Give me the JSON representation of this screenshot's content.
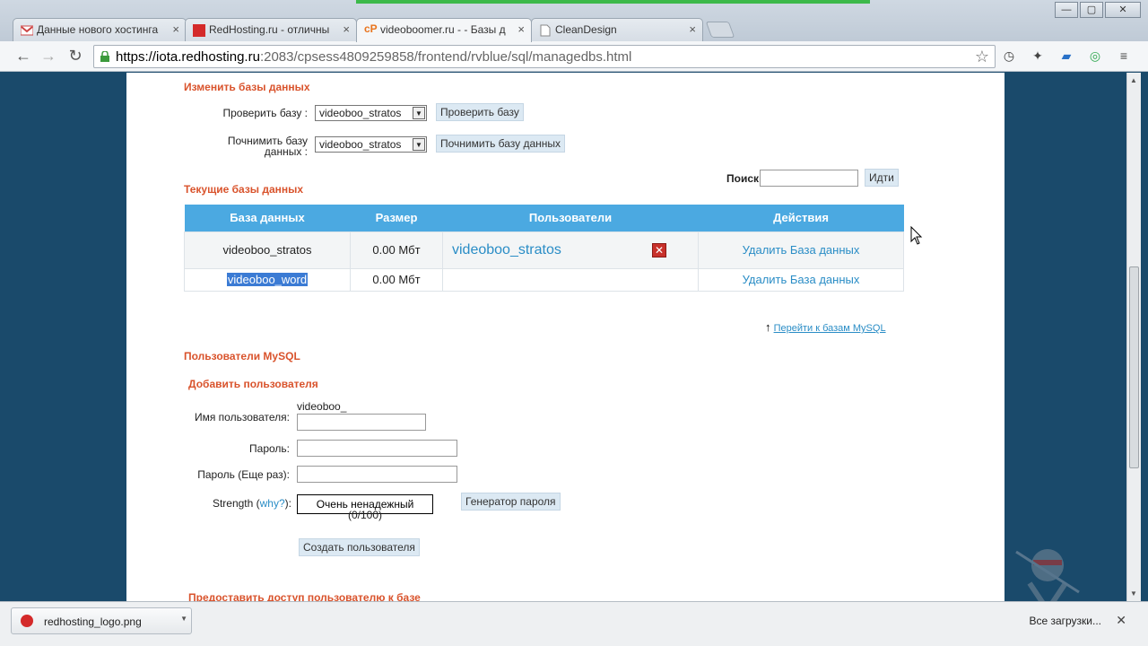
{
  "browser": {
    "tabs": [
      {
        "label": "Данные нового хостинга"
      },
      {
        "label": "RedHosting.ru - отличны"
      },
      {
        "label": "videoboomer.ru - - Базы д"
      },
      {
        "label": "CleanDesign"
      }
    ],
    "url_host": "https://iota.redhosting.ru",
    "url_path": ":2083/cpsess4809259858/frontend/rvblue/sql/managedbs.html",
    "window_min": "—",
    "window_max": "▢",
    "window_close": "✕"
  },
  "modify_db": {
    "title": "Изменить базы данных",
    "check_label": "Проверить базу :",
    "check_value": "videoboo_stratos",
    "check_button": "Проверить базу",
    "repair_label_1": "Почнимить базу",
    "repair_label_2": "данных :",
    "repair_value": "videoboo_stratos",
    "repair_button": "Почнимить базу данных"
  },
  "search": {
    "label": "Поиск",
    "button": "Идти"
  },
  "current_db": {
    "title": "Текущие базы данных",
    "columns": [
      "База данных",
      "Размер",
      "Пользователи",
      "Действия"
    ],
    "rows": [
      {
        "name": "videoboo_stratos",
        "size": "0.00 Мбт",
        "user": "videoboo_stratos",
        "action": "Удалить База данных"
      },
      {
        "name": "videoboo_word",
        "size": "0.00 Мбт",
        "user": "",
        "action": "Удалить База данных"
      }
    ],
    "goto_link": "Перейти к базам MySQL"
  },
  "mysql_users": {
    "title": "Пользователи MySQL",
    "add_title": "Добавить пользователя",
    "username_label": "Имя пользователя:",
    "username_prefix": "videoboo_",
    "password_label": "Пароль:",
    "password_again_label": "Пароль (Еще раз):",
    "strength_label": "Strength (",
    "strength_why": "why?",
    "strength_label_end": "):",
    "strength_value": "Очень ненадежный",
    "strength_score": "(0/100)",
    "generator_button": "Генератор пароля",
    "create_button": "Создать пользователя",
    "grant_title": "Предоставить доступ пользователю к базе"
  },
  "downloads": {
    "file": "redhosting_logo.png",
    "all": "Все загрузки...",
    "close": "✕"
  },
  "colors": {
    "accent": "#4ba9e1",
    "section_title": "#d9532c",
    "page_bg": "#1a4a6b",
    "link": "#2a8dc6"
  }
}
